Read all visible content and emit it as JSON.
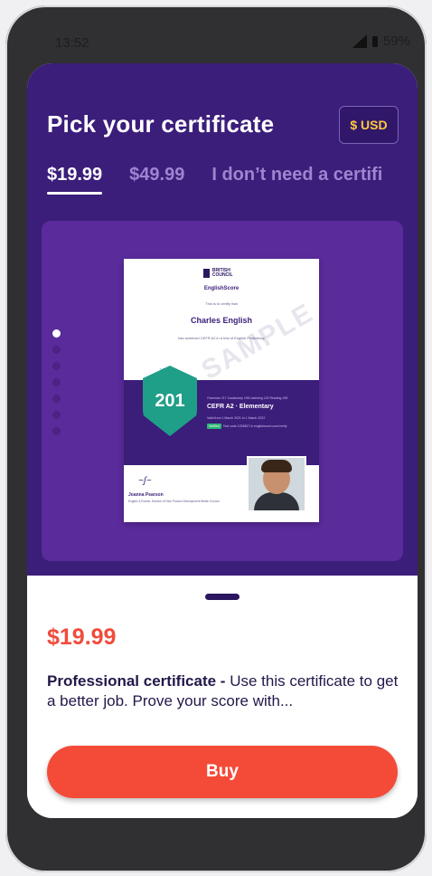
{
  "status": {
    "time": "13:52",
    "battery": "59%"
  },
  "header": {
    "title": "Pick your certificate",
    "currency": "$ USD"
  },
  "tabs": [
    {
      "label": "$19.99",
      "active": true
    },
    {
      "label": "$49.99",
      "active": false
    },
    {
      "label": "I don’t need a certifi",
      "active": false
    }
  ],
  "carousel": {
    "dots": 7,
    "active_index": 0
  },
  "certificate": {
    "brand": "EnglishScore",
    "logo_text": "BRITISH COUNCIL",
    "certify_text": "This is to certify that",
    "name": "Charles English",
    "achieved_text": "has achieved CEFR A2 in a test of English Proficiency",
    "score": "201",
    "watermark": "SAMPLE",
    "subscores": "Grammar 217   Vocabulary 198   Listening 129   Reading 198",
    "level": "CEFR A2 · Elementary",
    "valid": "Valid from 1 March 2021 to 1 March 2022",
    "verified_label": "Verified",
    "verified_text": "Test code 1234567 in englishscore.com/verify",
    "signer_name": "Joanna Pearson",
    "signer_role": "English & Exams, Director of New Product Development British Council"
  },
  "sheet": {
    "price": "$19.99",
    "desc_bold": "Professional certificate - ",
    "desc_text": "Use this certificate to get a better job. Prove your score with...",
    "buy_label": "Buy"
  },
  "colors": {
    "hero": "#3b1d7a",
    "accent": "#f44b39",
    "currency": "#ffc93c"
  }
}
